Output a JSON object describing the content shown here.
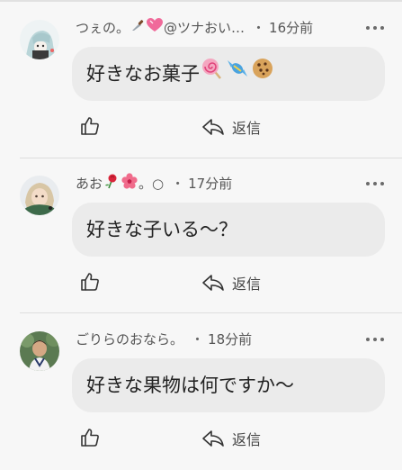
{
  "comments": [
    {
      "author": "つぇの。",
      "author_suffix": "@ツナおい…",
      "author_emojis": [
        "knife-emoji",
        "pink-heart-emoji"
      ],
      "time": "16分前",
      "text": "好きなお菓子",
      "text_emojis": [
        "lollipop-emoji",
        "candy-emoji",
        "cookie-emoji"
      ],
      "reply_label": "返信"
    },
    {
      "author": "あお",
      "author_emojis": [
        "rose-emoji",
        "hibiscus-emoji"
      ],
      "author_suffix": "。○",
      "time": "17分前",
      "text": "好きな子いる〜？",
      "reply_label": "返信"
    },
    {
      "author": "ごりらのおなら。",
      "time": "18分前",
      "text": "好きな果物は何ですか〜",
      "reply_label": "返信"
    }
  ],
  "separator": "・",
  "colors": {
    "background": "#f7f7f7",
    "bubble": "#ebebeb",
    "text": "#222222",
    "meta": "#555555"
  }
}
